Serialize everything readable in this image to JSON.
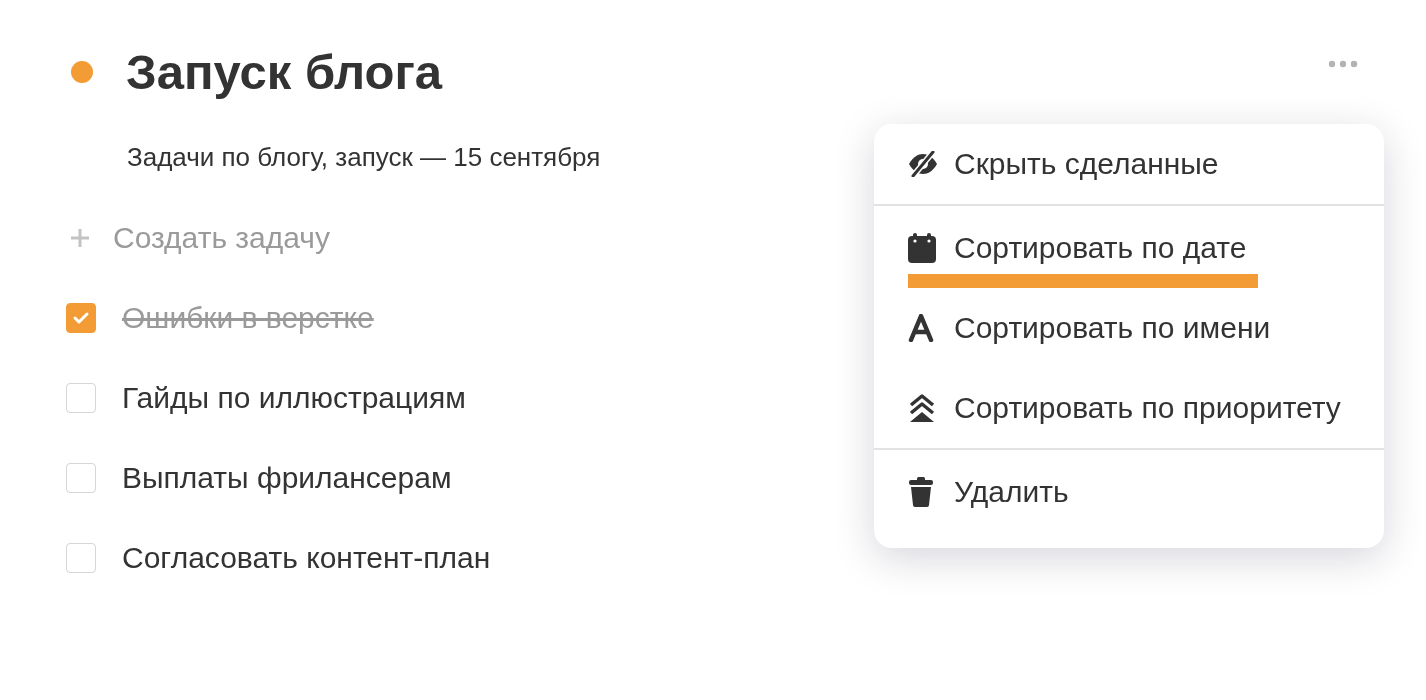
{
  "project": {
    "title": "Запуск блога",
    "color": "#f39c35",
    "description": "Задачи по блогу, запуск — 15 сентября"
  },
  "new_task": {
    "label": "Создать задачу"
  },
  "tasks": [
    {
      "title": "Ошибки в верстке",
      "checked": true
    },
    {
      "title": "Гайды по иллюстрациям",
      "checked": false
    },
    {
      "title": "Выплаты фрилансерам",
      "checked": false
    },
    {
      "title": "Согласовать контент-план",
      "checked": false
    }
  ],
  "menu": {
    "groups": [
      [
        {
          "kind": "hide",
          "label": "Скрыть сделанные",
          "selected": false
        }
      ],
      [
        {
          "kind": "date",
          "label": "Сортировать по дате",
          "selected": true
        },
        {
          "kind": "name",
          "label": "Сортировать по имени",
          "selected": false
        },
        {
          "kind": "priority",
          "label": "Сортировать по приоритету",
          "selected": false
        }
      ],
      [
        {
          "kind": "delete",
          "label": "Удалить",
          "selected": false
        }
      ]
    ]
  }
}
